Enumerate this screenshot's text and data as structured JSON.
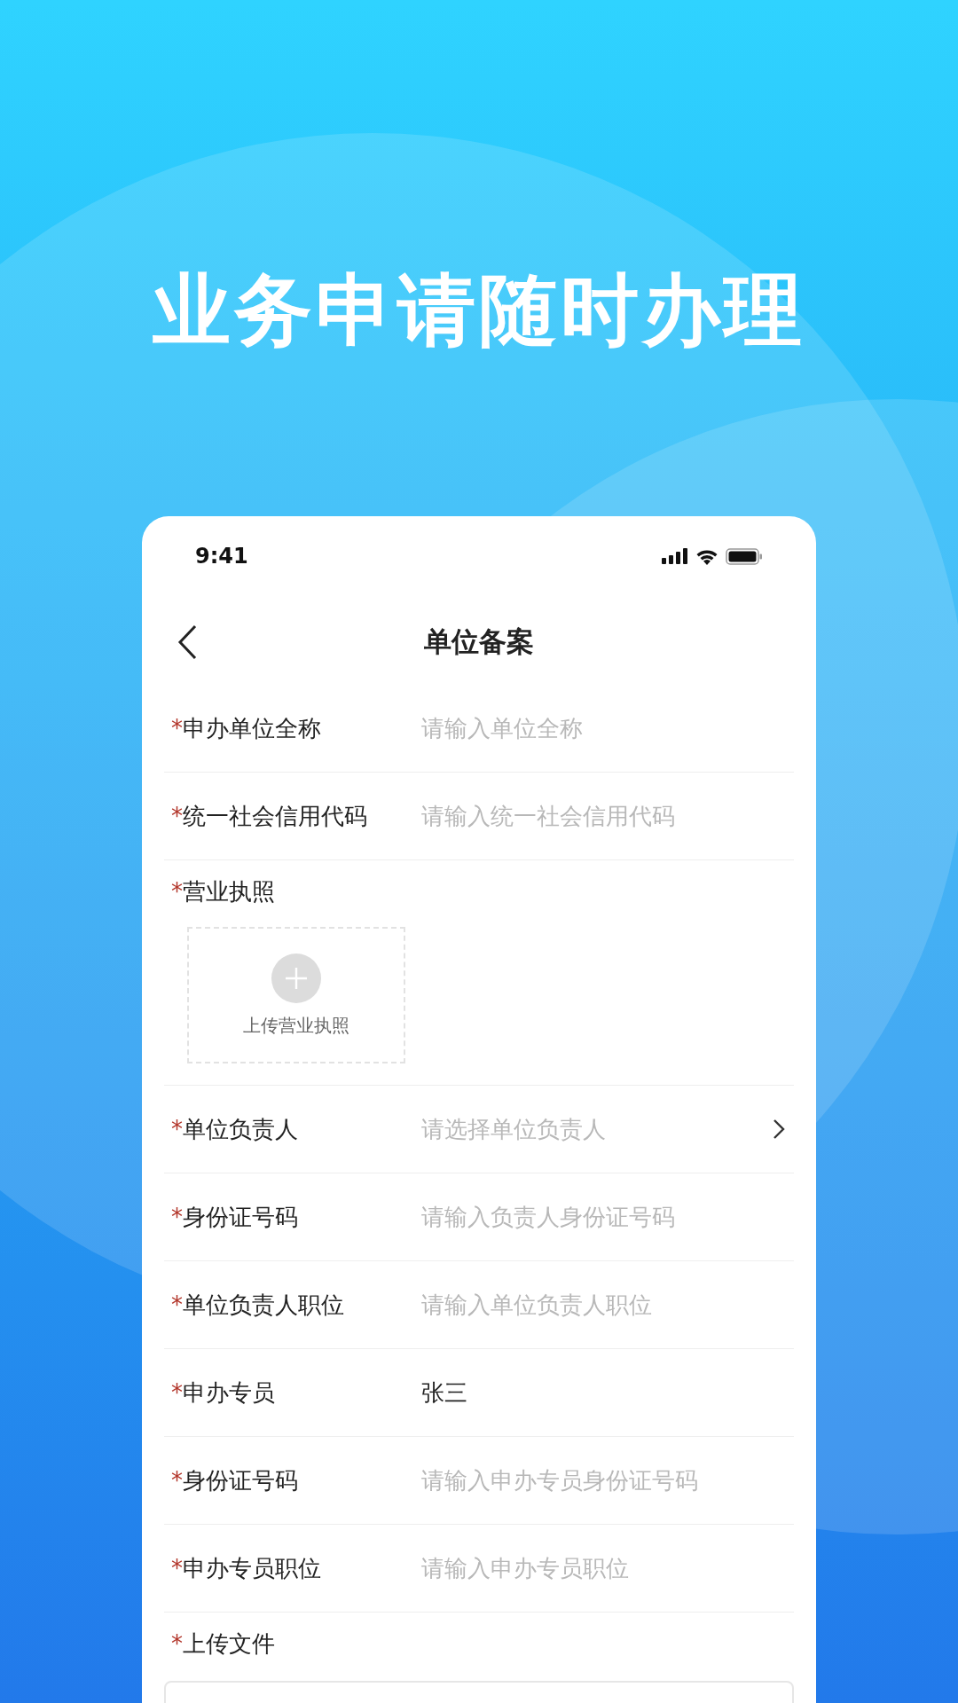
{
  "headline": "业务申请随时办理",
  "status_bar": {
    "time": "9:41"
  },
  "nav": {
    "title": "单位备案"
  },
  "fields": [
    {
      "kind": "input",
      "label": "申办单位全称",
      "required_mark": "*",
      "placeholder": "请输入单位全称"
    },
    {
      "kind": "input",
      "label": "统一社会信用代码",
      "required_mark": "*",
      "placeholder": "请输入统一社会信用代码"
    },
    {
      "kind": "upload",
      "label": "营业执照",
      "required_mark": "*",
      "button": "上传营业执照"
    },
    {
      "kind": "select",
      "label": "单位负责人",
      "required_mark": "*",
      "placeholder": "请选择单位负责人"
    },
    {
      "kind": "input",
      "label": "身份证号码",
      "required_mark": "*",
      "placeholder": "请输入负责人身份证号码"
    },
    {
      "kind": "input",
      "label": "单位负责人职位",
      "required_mark": "*",
      "placeholder": "请输入单位负责人职位"
    },
    {
      "kind": "input",
      "label": "申办专员",
      "required_mark": "*",
      "value": "张三"
    },
    {
      "kind": "input",
      "label": "身份证号码",
      "required_mark": "*",
      "placeholder": "请输入申办专员身份证号码"
    },
    {
      "kind": "input",
      "label": "申办专员职位",
      "required_mark": "*",
      "placeholder": "请输入申办专员职位"
    },
    {
      "kind": "file",
      "label": "上传文件",
      "required_mark": "*"
    }
  ]
}
